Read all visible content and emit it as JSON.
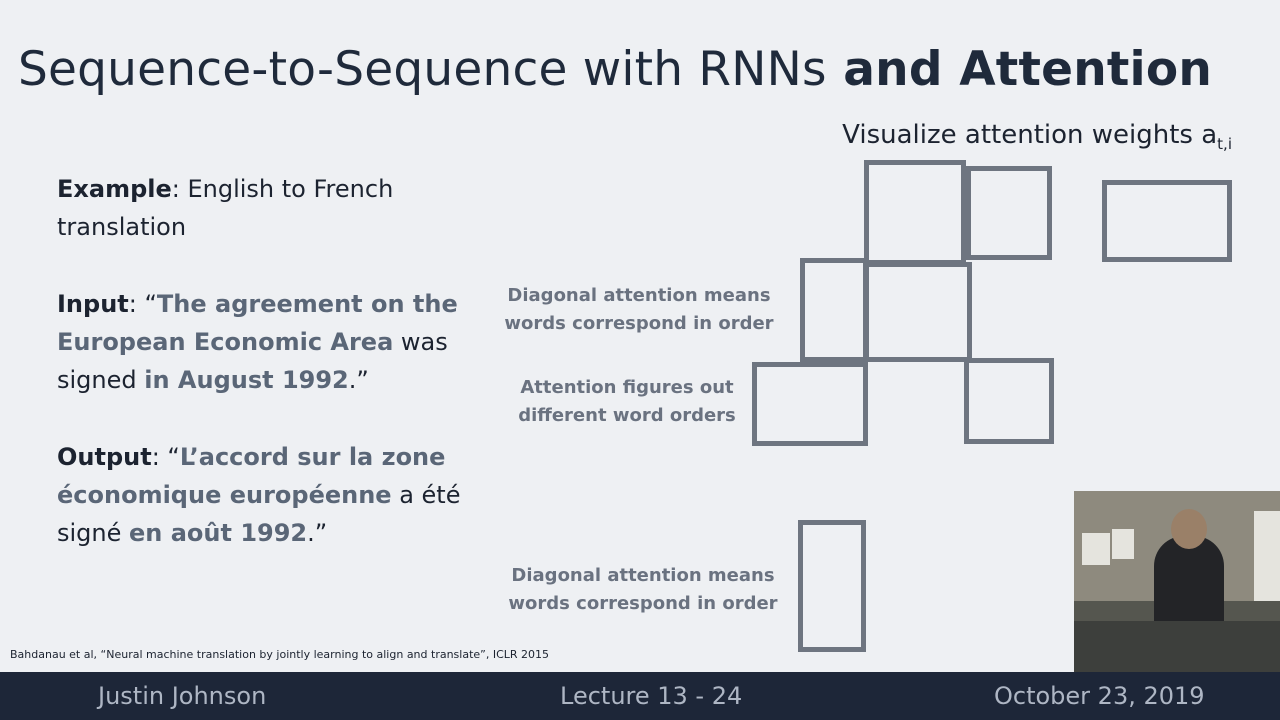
{
  "title": {
    "plain": "Sequence-to-Sequence with RNNs",
    "bold": " and Attention"
  },
  "viz_label": {
    "text": "Visualize attention weights a",
    "subscript": "t,i"
  },
  "example": {
    "label": "Example",
    "text": ": English to French translation"
  },
  "input": {
    "label": "Input",
    "part1": ": “",
    "part2": "The agreement on the European Economic Area",
    "part3": " was signed ",
    "part4": "in August 1992",
    "part5": ".”"
  },
  "output": {
    "label": "Output",
    "part1": ": “",
    "part2": "L’accord sur la zone économique européenne",
    "part3": " a été signé ",
    "part4": "en août 1992",
    "part5": ".”"
  },
  "annotations": {
    "diag1": "Diagonal attention means words correspond in order",
    "figures": "Attention figures out different word orders",
    "diag2": "Diagonal attention means words correspond in order"
  },
  "citation": "Bahdanau et al, “Neural machine translation by jointly learning to align and translate”, ICLR 2015",
  "footer": {
    "left": "Justin Johnson",
    "center": "Lecture 13 - 24",
    "right": "October 23, 2019"
  }
}
